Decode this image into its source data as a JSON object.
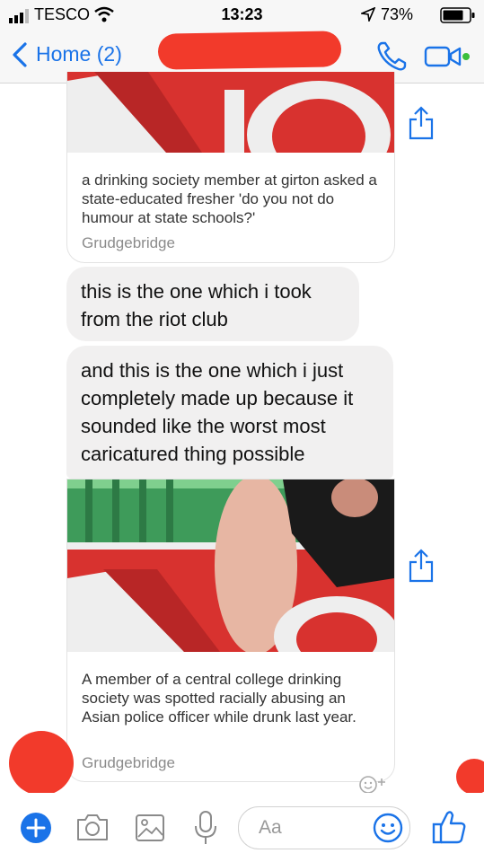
{
  "status_bar": {
    "carrier": "TESCO",
    "time": "13:23",
    "battery": "73%"
  },
  "nav": {
    "back_label": "Home (2)"
  },
  "messages": {
    "card1": {
      "description": "a drinking society member at girton asked a state-educated fresher 'do you not do humour at state schools?'",
      "source": "Grudgebridge"
    },
    "bubble1": "this is the one which i took from the riot club",
    "bubble2": "and this is the one which i just completely made up because it sounded like the worst most caricatured thing possible",
    "card2": {
      "description": "A member of a central college drinking society was spotted racially abusing an Asian police officer while drunk last year.",
      "source": "Grudgebridge"
    }
  },
  "composer": {
    "placeholder": "Aa"
  },
  "colors": {
    "accent": "#1a73e8",
    "bubble": "#f1f0f0",
    "redaction": "#f23a2b"
  }
}
